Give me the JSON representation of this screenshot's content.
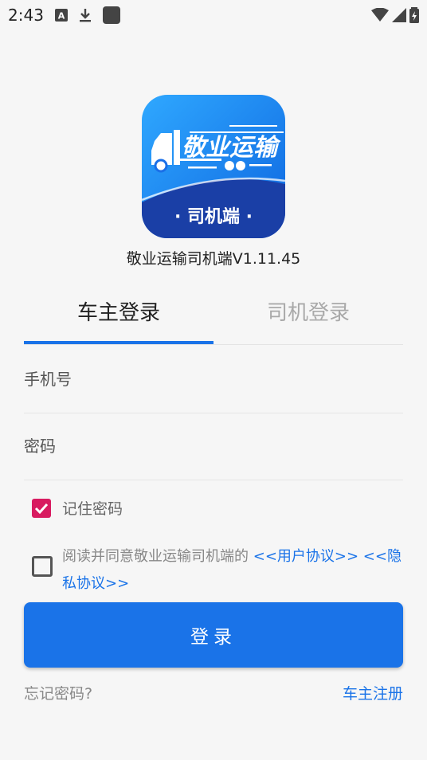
{
  "status_bar": {
    "time": "2:43"
  },
  "logo": {
    "name": "敬业运输",
    "subtitle": "· 司机端 ·"
  },
  "app": {
    "version_title": "敬业运输司机端V1.11.45"
  },
  "tabs": [
    {
      "label": "车主登录",
      "active": true
    },
    {
      "label": "司机登录",
      "active": false
    }
  ],
  "form": {
    "phone_placeholder": "手机号",
    "password_placeholder": "密码",
    "remember_label": "记住密码",
    "remember_checked": true,
    "agreement_prefix": "阅读并同意敬业运输司机端的",
    "user_agreement": "<<用户协议>>",
    "privacy_agreement": "<<隐私协议>>",
    "agreement_checked": false,
    "login_label": "登录"
  },
  "footer": {
    "forgot_password": "忘记密码?",
    "register": "车主注册"
  },
  "colors": {
    "primary": "#1a73e8",
    "checkbox_checked": "#d81b60",
    "tab_inactive": "#a9a9a9"
  }
}
